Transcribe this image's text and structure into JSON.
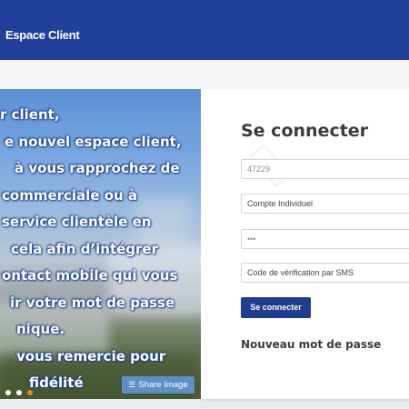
{
  "header": {
    "brand": "Espace Client",
    "color": "#21409a"
  },
  "banner": {
    "lines": [
      "r client,",
      "e nouvel espace client,",
      "à vous rapprochez de",
      "commerciale ou à",
      "service clientèle en",
      "cela afin d’intégrer",
      "ontact mobile qui vous",
      "ir votre mot de passe",
      "nique.",
      "vous remercie pour",
      "fidélité"
    ],
    "share_label": "Share Image",
    "share_icon": "layers-icon",
    "dots": 3,
    "active_dot": 2
  },
  "login": {
    "title": "Se connecter",
    "account_number_value": "47229",
    "account_type_value": "Compte Individuel",
    "password_value": "•••",
    "sms_placeholder": "Code de vérification par SMS",
    "submit_label": "Se connecter",
    "forgot_label": "Nouveau mot de passe",
    "accent": "#213d8d"
  }
}
